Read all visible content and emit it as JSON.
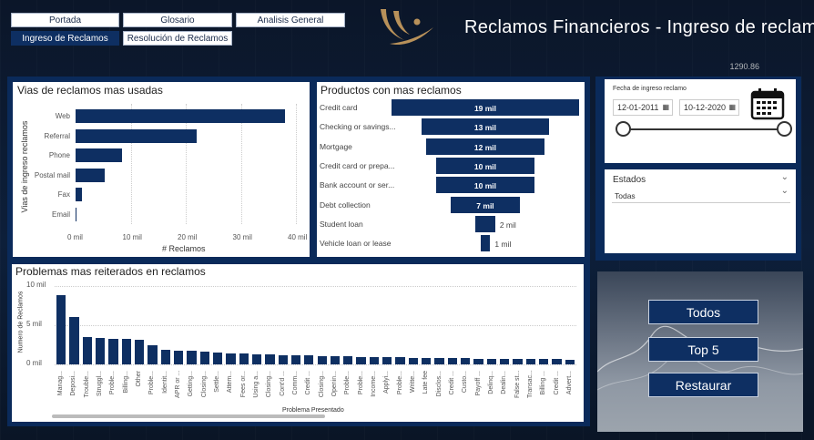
{
  "nav": {
    "tabs": [
      {
        "label": "Portada"
      },
      {
        "label": "Glosario"
      },
      {
        "label": "Analisis General"
      },
      {
        "label": "Ingreso de Reclamos"
      },
      {
        "label": "Resolución de Reclamos"
      }
    ],
    "active_tab": "Ingreso de Reclamos"
  },
  "header": {
    "title": "Reclamos Financieros - Ingreso de reclamos",
    "background_number": "1290.86"
  },
  "colors": {
    "bar": "#0e2f62",
    "panel_frame": "#0a2a5a",
    "background": "#0c1a30",
    "logo_gold": "#b8915a"
  },
  "vias_chart": {
    "title": "Vias de reclamos mas usadas",
    "chart_data": {
      "type": "bar",
      "orientation": "horizontal",
      "categories": [
        "Web",
        "Referral",
        "Phone",
        "Postal mail",
        "Fax",
        "Email"
      ],
      "values": [
        38,
        22,
        8.5,
        5.3,
        1.1,
        0.2
      ],
      "xlabel": "# Reclamos",
      "ylabel": "Vias de ingreso reclamos",
      "xlim": [
        0,
        40
      ],
      "tick_labels": [
        "0 mil",
        "10 mil",
        "20 mil",
        "30 mil",
        "40 mil"
      ],
      "grid": true
    }
  },
  "productos_chart": {
    "title": "Productos con mas reclamos",
    "chart_data": {
      "type": "bar",
      "orientation": "funnel",
      "categories": [
        "Credit card",
        "Checking or savings...",
        "Mortgage",
        "Credit card or prepa...",
        "Bank account or ser...",
        "Debt collection",
        "Student loan",
        "Vehicle loan or lease"
      ],
      "values": [
        19,
        13,
        12,
        10,
        10,
        7,
        2,
        1
      ],
      "data_labels": [
        "19 mil",
        "13 mil",
        "12 mil",
        "10 mil",
        "10 mil",
        "7 mil",
        "2 mil",
        "1 mil"
      ]
    }
  },
  "filters": {
    "date_label": "Fecha de ingreso reclamo",
    "date_from": "12-01-2011",
    "date_to": "10-12-2020",
    "range": [
      0,
      1
    ],
    "estados_label": "Estados",
    "estados_value": "Todas"
  },
  "problemas_chart": {
    "title": "Problemas mas reiterados en reclamos",
    "chart_data": {
      "type": "bar",
      "categories": [
        "Manag...",
        "Deposi...",
        "Trouble...",
        "Struggl...",
        "Proble...",
        "Billing...",
        "Other",
        "Proble...",
        "Identit...",
        "APR or ...",
        "Getting...",
        "Closing...",
        "Settle...",
        "Attem...",
        "Fees or...",
        "Using a...",
        "Closing...",
        "Cont'd ...",
        "Comm...",
        "Credit ...",
        "Closing...",
        "Openin...",
        "Proble...",
        "Proble...",
        "Income...",
        "Applyi...",
        "Proble...",
        "Writte...",
        "Late fee",
        "Disclos...",
        "Credit ...",
        "Custo...",
        "Payoff ...",
        "Delinq...",
        "Dealin...",
        "False st...",
        "Transac...",
        "Billing ...",
        "Credit ...",
        "Advert..."
      ],
      "values": [
        8.8,
        6.1,
        3.5,
        3.4,
        3.3,
        3.2,
        3.1,
        2.5,
        1.9,
        1.8,
        1.7,
        1.6,
        1.5,
        1.4,
        1.35,
        1.3,
        1.25,
        1.2,
        1.2,
        1.15,
        1.1,
        1.05,
        1.0,
        0.95,
        0.95,
        0.9,
        0.9,
        0.85,
        0.85,
        0.8,
        0.8,
        0.8,
        0.75,
        0.75,
        0.7,
        0.7,
        0.7,
        0.65,
        0.65,
        0.6
      ],
      "xlabel": "Problema Presentado",
      "ylabel": "Numero de Reclamos",
      "ylim": [
        0,
        10
      ],
      "tick_labels": [
        "0 mil",
        "5 mil",
        "10 mil"
      ],
      "grid": true
    }
  },
  "actions": {
    "todos": "Todos",
    "top5": "Top 5",
    "restaurar": "Restaurar"
  }
}
